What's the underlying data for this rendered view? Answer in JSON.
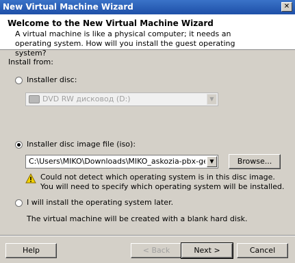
{
  "window": {
    "title": "New Virtual Machine Wizard",
    "close_symbol": "✕"
  },
  "header": {
    "title": "Welcome to the New Virtual Machine Wizard",
    "description": "A virtual machine is like a physical computer; it needs an operating system. How will you install the guest operating system?"
  },
  "install_from_label": "Install from:",
  "options": {
    "installer_disc": {
      "label": "Installer disc:",
      "selected": false,
      "drive_value": "DVD RW дисковод (D:)"
    },
    "iso": {
      "label": "Installer disc image file (iso):",
      "selected": true,
      "path_value": "C:\\Users\\MIKO\\Downloads\\MIKO_askozia-pbx-generic",
      "browse_label": "Browse...",
      "warning_line1": "Could not detect which operating system is in this disc image.",
      "warning_line2": "You will need to specify which operating system will be installed."
    },
    "later": {
      "label": "I will install the operating system later.",
      "selected": false,
      "note": "The virtual machine will be created with a blank hard disk."
    }
  },
  "footer": {
    "help_label": "Help",
    "back_label": "< Back",
    "next_label": "Next >",
    "cancel_label": "Cancel"
  },
  "icons": {
    "disc": "disc-drive-icon",
    "warning": "warning-icon",
    "dropdown": "chevron-down-icon"
  },
  "colors": {
    "titlebar": "#1e4fa8",
    "dialog_bg": "#d4d0c8",
    "warning_yellow": "#f2d200"
  }
}
